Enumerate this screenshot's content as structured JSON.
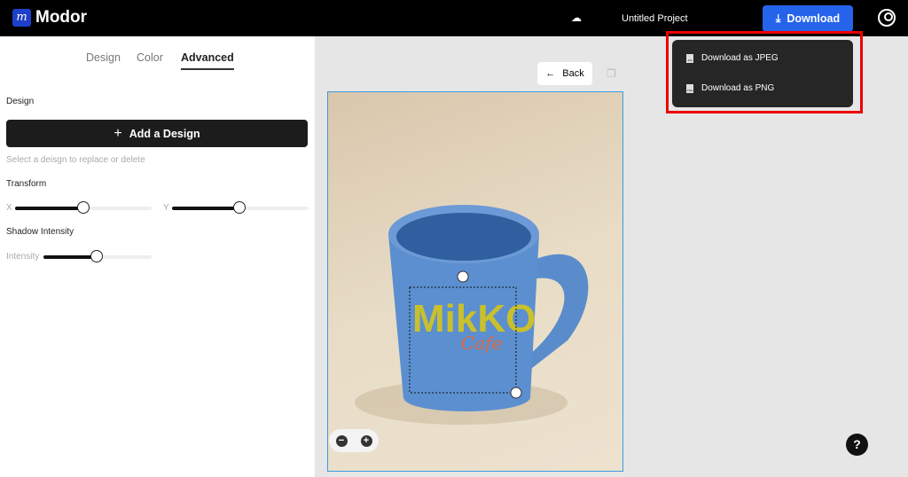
{
  "header": {
    "brand": "Modor",
    "logo_letter": "m",
    "project": "Untitled Project",
    "download": "Download"
  },
  "sidebar": {
    "tabs": [
      {
        "label": "Design"
      },
      {
        "label": "Color"
      },
      {
        "label": "Advanced",
        "active": true
      }
    ],
    "design_label": "Design",
    "add_design": "Add a Design",
    "hint": "Select a deisgn to replace or delete",
    "transform_label": "Transform",
    "x_label": "X",
    "y_label": "Y",
    "x_value": 0.5,
    "y_value": 0.5,
    "shadow_label": "Shadow Intensity",
    "intensity_label": "Intensity",
    "intensity_value": 0.5
  },
  "canvas": {
    "back": "Back",
    "design_text": "MikKO",
    "design_sub": "Cafe",
    "mug_color": "#5b8fd0"
  },
  "download_menu": {
    "items": [
      {
        "label": "Download as JPEG",
        "icon": "JPG"
      },
      {
        "label": "Download as PNG",
        "icon": "PNG"
      }
    ]
  },
  "help": "?"
}
